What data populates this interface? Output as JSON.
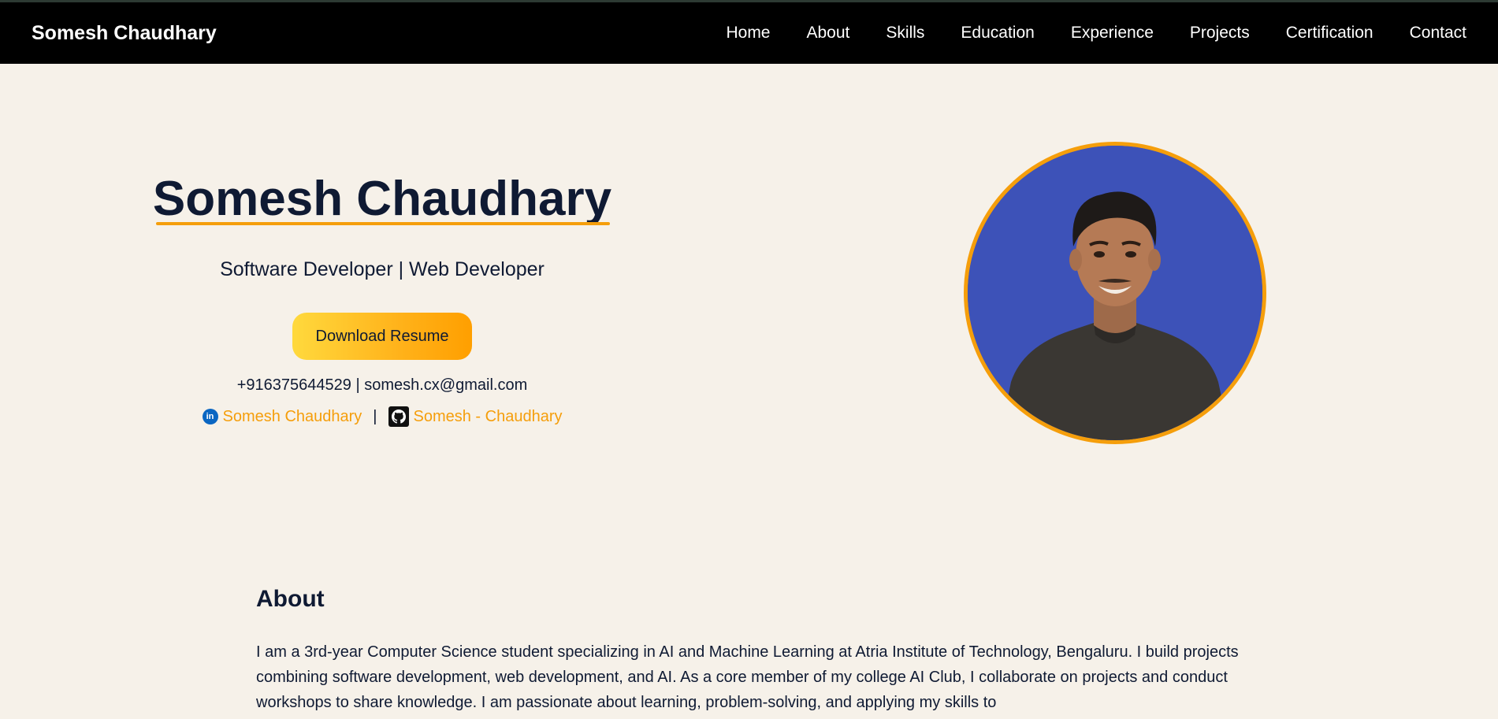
{
  "navbar": {
    "brand": "Somesh Chaudhary",
    "links": [
      "Home",
      "About",
      "Skills",
      "Education",
      "Experience",
      "Projects",
      "Certification",
      "Contact"
    ]
  },
  "hero": {
    "name": "Somesh Chaudhary",
    "tagline": "Software Developer | Web Developer",
    "download_label": "Download Resume",
    "contact": "+916375644529 | somesh.cx@gmail.com",
    "linkedin_label": "Somesh Chaudhary",
    "github_label": "Somesh - Chaudhary",
    "separator": "|"
  },
  "about": {
    "heading": "About",
    "text": "I am a 3rd-year Computer Science student specializing in AI and Machine Learning at Atria Institute of Technology, Bengaluru. I build projects combining software development, web development, and AI. As a core member of my college AI Club, I collaborate on projects and conduct workshops to share knowledge. I am passionate about learning, problem-solving, and applying my skills to"
  },
  "colors": {
    "background": "#f6f1e9",
    "navbar": "#000000",
    "accent": "#f59e0b",
    "text": "#0f1a33",
    "avatar_bg": "#3d52b8"
  },
  "icons": {
    "linkedin": "linkedin-icon",
    "github": "github-icon"
  }
}
